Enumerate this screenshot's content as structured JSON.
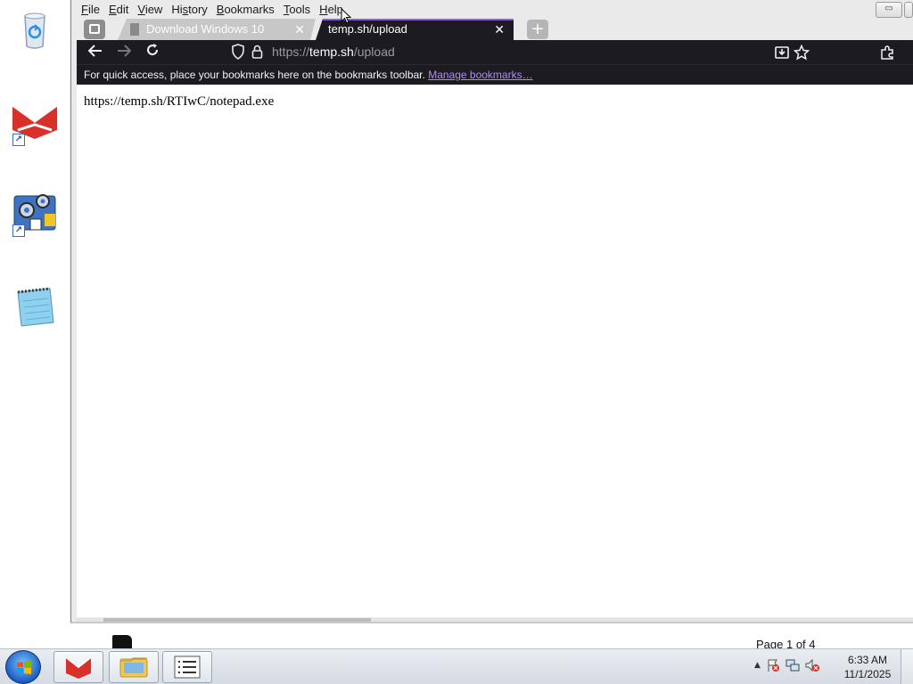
{
  "desktop": {
    "icons": [
      "recycle-bin-icon",
      "browser-shortcut-icon",
      "settings-shortcut-icon",
      "notepad-icon"
    ],
    "background_page_text": "Page 1 of 4"
  },
  "browser": {
    "menu": {
      "file": {
        "ul": "F",
        "rest": "ile"
      },
      "edit": {
        "ul": "E",
        "rest": "dit"
      },
      "view": {
        "ul": "V",
        "rest": "iew"
      },
      "history": {
        "pre": "Hi",
        "ul": "s",
        "rest": "tory"
      },
      "bookmarks": {
        "ul": "B",
        "rest": "ookmarks"
      },
      "tools": {
        "ul": "T",
        "rest": "ools"
      },
      "help": {
        "ul": "H",
        "rest": "elp"
      }
    },
    "tabs": [
      {
        "title": "Download Windows 10",
        "close": "✕"
      },
      {
        "title": "temp.sh/upload",
        "close": "✕"
      }
    ],
    "new_tab": "+",
    "url": {
      "scheme": "https://",
      "host": "temp.sh",
      "path": "/upload"
    },
    "bookmarks_bar": {
      "text": "For quick access, place your bookmarks here on the bookmarks toolbar.",
      "link": "Manage bookmarks…"
    },
    "page_content": "https://temp.sh/RTIwC/notepad.exe",
    "accent_color": "#8e5fd8",
    "toolbar_bg": "#1c1b22"
  },
  "taskbar": {
    "clock_time": "6:33 AM",
    "clock_date": "11/1/2025",
    "apps": [
      "browser-taskbar-icon",
      "file-explorer-taskbar-icon",
      "task-list-taskbar-icon"
    ]
  }
}
